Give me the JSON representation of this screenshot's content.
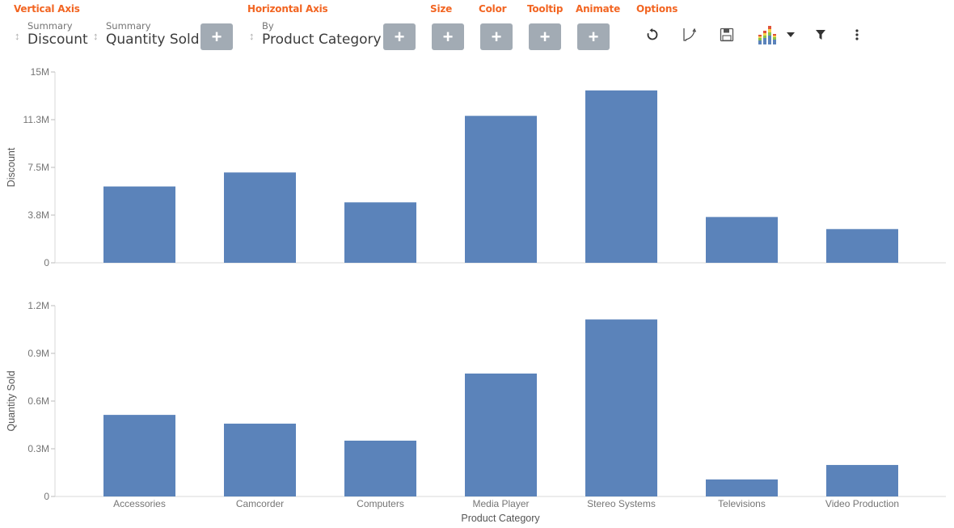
{
  "toolbar": {
    "vertical_axis": {
      "label": "Vertical Axis",
      "fields": [
        {
          "sub": "Summary",
          "main": "Discount"
        },
        {
          "sub": "Summary",
          "main": "Quantity Sold"
        }
      ],
      "add_label": "+"
    },
    "horizontal_axis": {
      "label": "Horizontal Axis",
      "field": {
        "sub": "By",
        "main": "Product Category"
      },
      "add_label": "+"
    },
    "size": {
      "label": "Size",
      "add_label": "+"
    },
    "color": {
      "label": "Color",
      "add_label": "+"
    },
    "tooltip": {
      "label": "Tooltip",
      "add_label": "+"
    },
    "animate": {
      "label": "Animate",
      "add_label": "+"
    },
    "options": {
      "label": "Options",
      "icons": [
        "refresh-icon",
        "curve-edit-icon",
        "save-icon",
        "chart-type-icon",
        "dropdown-caret-icon",
        "filter-icon",
        "more-vert-icon"
      ]
    }
  },
  "colors": {
    "accent": "#f26522",
    "bar": "#5b83ba",
    "add_button": "#a2abb4"
  },
  "chart_data": [
    {
      "type": "bar",
      "title": "",
      "xlabel": "",
      "ylabel": "Discount",
      "categories": [
        "Accessories",
        "Camcorder",
        "Computers",
        "Media Player",
        "Stereo Systems",
        "Televisions",
        "Video Production"
      ],
      "values": [
        6000000,
        7100000,
        4750000,
        11550000,
        13550000,
        3600000,
        2650000
      ],
      "ylim": [
        0,
        15000000
      ],
      "yticks": [
        0,
        3750000,
        7500000,
        11250000,
        15000000
      ],
      "ytick_labels": [
        "0",
        "3.8M",
        "7.5M",
        "11.3M",
        "15M"
      ],
      "grid": false,
      "legend": "none"
    },
    {
      "type": "bar",
      "title": "",
      "xlabel": "Product Category",
      "ylabel": "Quantity Sold",
      "categories": [
        "Accessories",
        "Camcorder",
        "Computers",
        "Media Player",
        "Stereo Systems",
        "Televisions",
        "Video Production"
      ],
      "values": [
        513000,
        458000,
        351000,
        773000,
        1113000,
        107000,
        198000
      ],
      "ylim": [
        0,
        1200000
      ],
      "yticks": [
        0,
        300000,
        600000,
        900000,
        1200000
      ],
      "ytick_labels": [
        "0",
        "0.3M",
        "0.6M",
        "0.9M",
        "1.2M"
      ],
      "grid": false,
      "legend": "none"
    }
  ]
}
